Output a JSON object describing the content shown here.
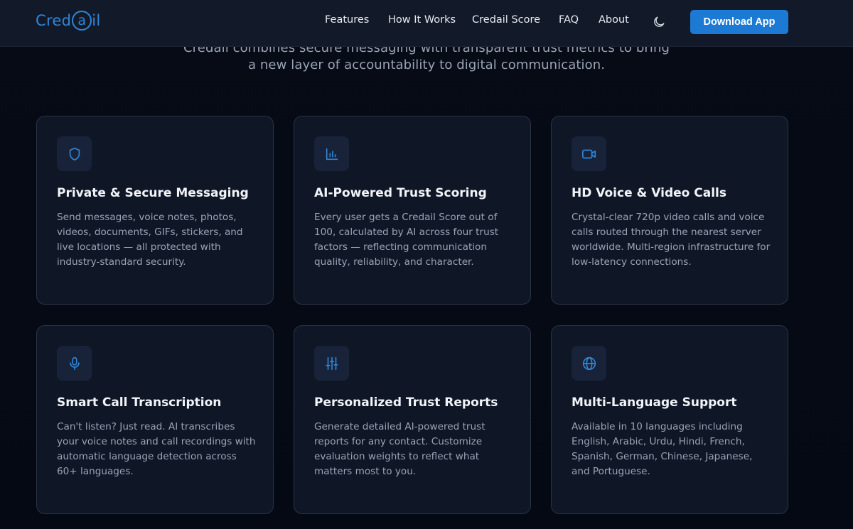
{
  "header": {
    "logo_prefix": "Cred",
    "logo_ring": "a",
    "logo_suffix": "il",
    "nav": [
      "Features",
      "How It Works",
      "Credail Score",
      "FAQ",
      "About"
    ],
    "theme_icon": "moon-icon",
    "download_label": "Download App",
    "accent": "#1d7ad4"
  },
  "intro": {
    "line1": "Credail combines secure messaging with transparent trust metrics to bring",
    "line2": "a new layer of accountability to digital communication."
  },
  "features": [
    {
      "icon": "shield-icon",
      "title": "Private & Secure Messaging",
      "desc": "Send messages, voice notes, photos, videos, documents, GIFs, stickers, and live locations — all protected with industry-standard security."
    },
    {
      "icon": "bar-chart-icon",
      "title": "AI-Powered Trust Scoring",
      "desc": "Every user gets a Credail Score out of 100, calculated by AI across four trust factors — reflecting communication quality, reliability, and character."
    },
    {
      "icon": "video-icon",
      "title": "HD Voice & Video Calls",
      "desc": "Crystal-clear 720p video calls and voice calls routed through the nearest server worldwide. Multi-region infrastructure for low-latency connections."
    },
    {
      "icon": "microphone-icon",
      "title": "Smart Call Transcription",
      "desc": "Can't listen? Just read. AI transcribes your voice notes and call recordings with automatic language detection across 60+ languages."
    },
    {
      "icon": "sliders-icon",
      "title": "Personalized Trust Reports",
      "desc": "Generate detailed AI-powered trust reports for any contact. Customize evaluation weights to reflect what matters most to you."
    },
    {
      "icon": "globe-icon",
      "title": "Multi-Language Support",
      "desc": "Available in 10 languages including English, Arabic, Urdu, Hindi, French, Spanish, German, Chinese, Japanese, and Portuguese."
    }
  ]
}
